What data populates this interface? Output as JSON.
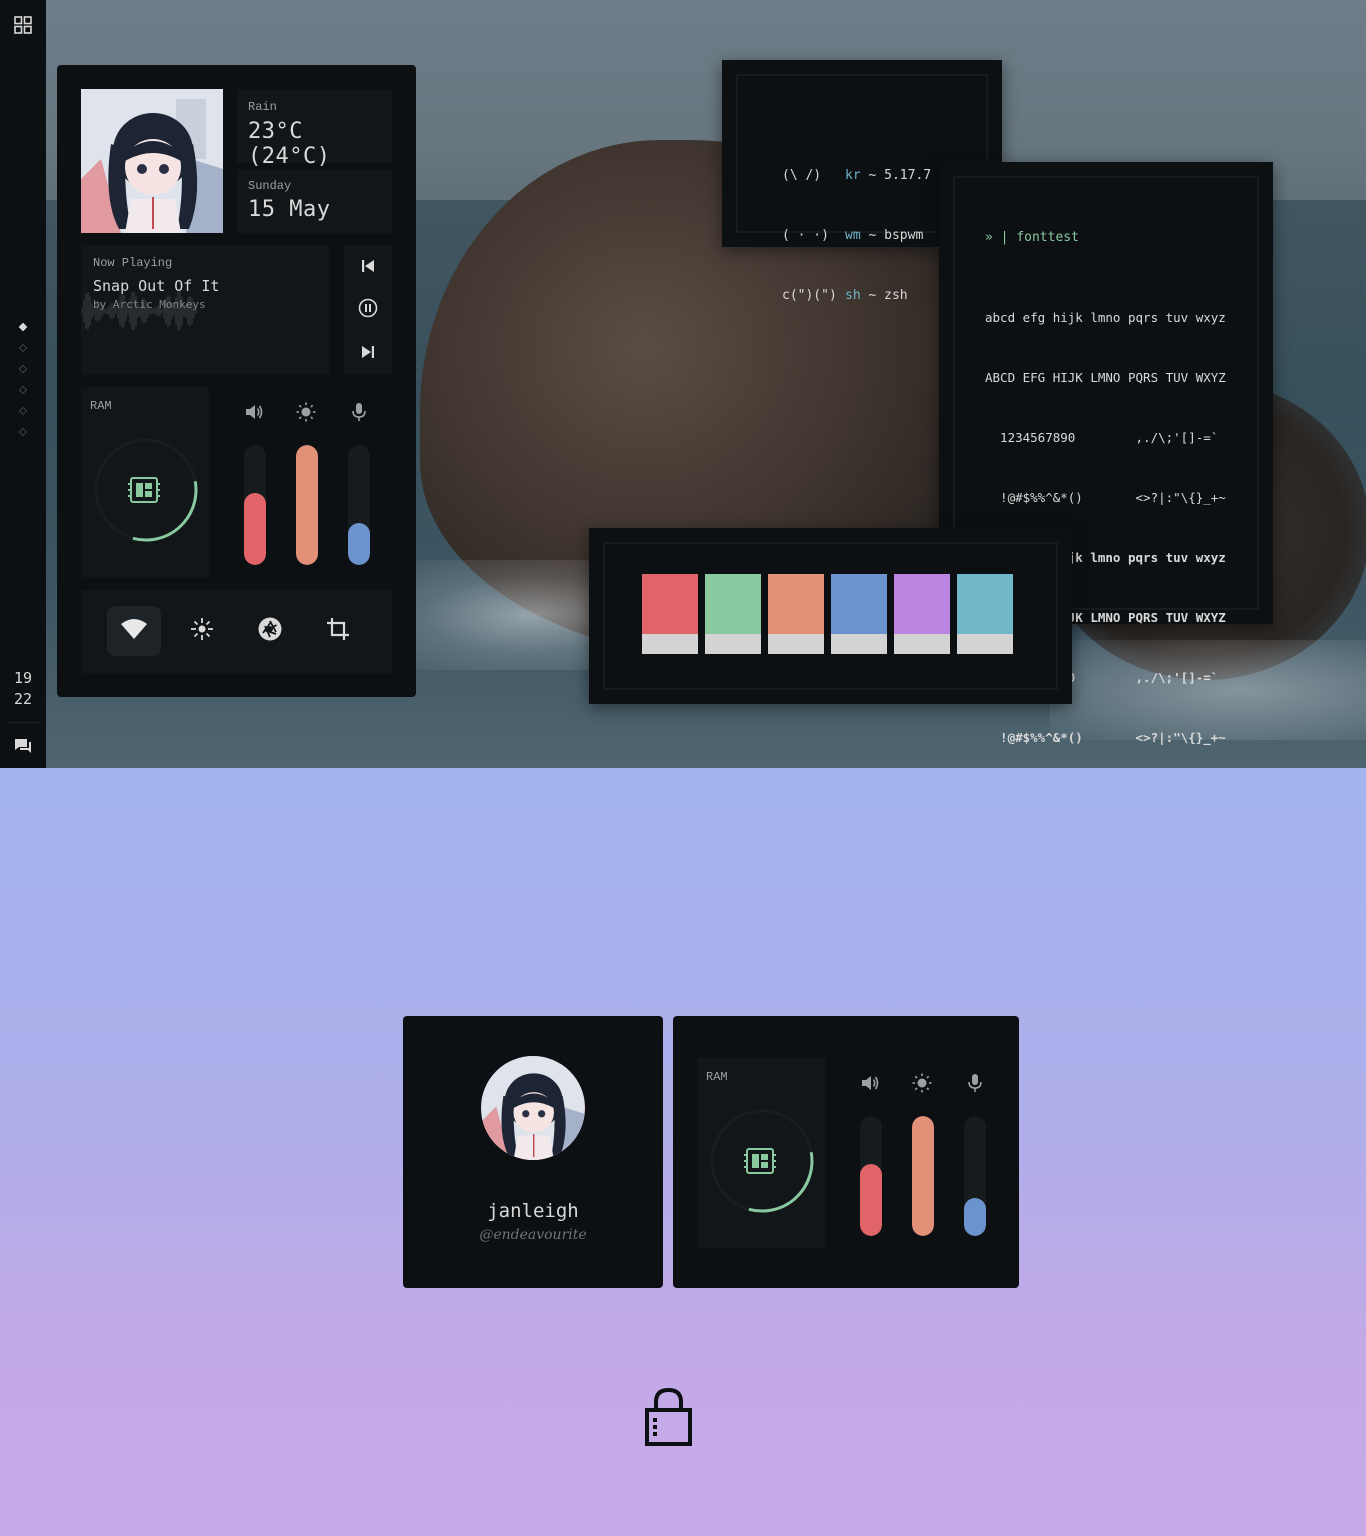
{
  "colors": {
    "bg_dark": "#0d1012",
    "tile": "#121619",
    "red": "#e06468",
    "green": "#89c9a0",
    "orange": "#e29178",
    "blue": "#6b93cd",
    "purple": "#bb84e0",
    "cyan": "#71b8cb",
    "swatch_light": "#d3d3d3"
  },
  "sidebar": {
    "clock_hour": "19",
    "clock_minute": "22",
    "workspaces": [
      {
        "active": true
      },
      {
        "active": false
      },
      {
        "active": false
      },
      {
        "active": false
      },
      {
        "active": false
      },
      {
        "active": false
      }
    ],
    "icons": {
      "top": "grid-icon",
      "bottom": "chat-icon"
    }
  },
  "dashboard": {
    "weather": {
      "label": "Rain",
      "temp": "23°C (24°C)"
    },
    "date": {
      "day": "Sunday",
      "date": "15 May"
    },
    "music": {
      "label": "Now Playing",
      "title": "Snap Out Of It",
      "artist": "by Arctic Monkeys",
      "controls": [
        "previous-icon",
        "pause-icon",
        "next-icon"
      ]
    },
    "ram": {
      "label": "RAM",
      "usage": 0.32,
      "icon": "memory-icon"
    },
    "sliders": [
      {
        "icon": "volume-icon",
        "level": 0.6,
        "color": "#e06468"
      },
      {
        "icon": "brightness-icon",
        "level": 1.0,
        "color": "#e29178"
      },
      {
        "icon": "microphone-icon",
        "level": 0.35,
        "color": "#6b93cd"
      }
    ],
    "quick_settings": [
      {
        "icon": "wifi-icon",
        "active": true
      },
      {
        "icon": "bluetooth-icon",
        "active": false
      },
      {
        "icon": "aperture-icon",
        "active": false
      },
      {
        "icon": "crop-icon",
        "active": false
      }
    ]
  },
  "fetch": {
    "art": [
      "(\\ /)",
      "( · ·)",
      "c(\")(\")"
    ],
    "rows": [
      {
        "key": "kr",
        "sep": "~",
        "value": "5.17.7"
      },
      {
        "key": "wm",
        "sep": "~",
        "value": "bspwm"
      },
      {
        "key": "sh",
        "sep": "~",
        "value": "zsh"
      }
    ]
  },
  "fonttest": {
    "prompt": "» |",
    "command": "fonttest",
    "lines": [
      "abcd efg hijk lmno pqrs tuv wxyz",
      "ABCD EFG HIJK LMNO PQRS TUV WXYZ",
      "  1234567890        ,./\\;'[]-=`",
      "  !@#$%%^&*()       <>?|:\"\\{}_+~"
    ]
  },
  "palette": {
    "swatches": [
      "#e06468",
      "#89c9a0",
      "#e29178",
      "#6b93cd",
      "#bb84e0",
      "#71b8cb"
    ]
  },
  "lockscreen": {
    "username": "janleigh",
    "handle": "@endeavourite",
    "lock_icon": "lock-icon",
    "ram": {
      "label": "RAM",
      "usage": 0.32
    },
    "sliders": [
      {
        "icon": "volume-icon",
        "level": 0.6,
        "color": "#e06468"
      },
      {
        "icon": "brightness-icon",
        "level": 1.0,
        "color": "#e29178"
      },
      {
        "icon": "microphone-icon",
        "level": 0.32,
        "color": "#6b93cd"
      }
    ]
  }
}
